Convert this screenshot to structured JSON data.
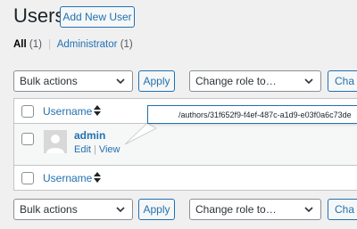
{
  "header": {
    "title": "Users",
    "add_new_label": "Add New User"
  },
  "views": {
    "all_label": "All",
    "all_count": "(1)",
    "separator": "|",
    "admin_label": "Administrator",
    "admin_count": "(1)"
  },
  "bulk_top": {
    "selected": "Bulk actions",
    "apply_label": "Apply"
  },
  "role_top": {
    "selected": "Change role to…",
    "change_label": "Cha"
  },
  "table": {
    "column_username": "Username"
  },
  "rows": [
    {
      "login": "admin",
      "edit_label": "Edit",
      "view_label": "View",
      "separator": "|"
    }
  ],
  "tooltip": {
    "text": "/authors/31f652f9-f4ef-487c-a1d9-e03f0a6c73de"
  },
  "bulk_bottom": {
    "selected": "Bulk actions",
    "apply_label": "Apply"
  },
  "role_bottom": {
    "selected": "Change role to…",
    "change_label": "Cha"
  },
  "icons": {
    "dropdown": "chevron-down-icon",
    "sort": "sort-arrows-icon",
    "avatar": "avatar-placeholder-icon"
  },
  "colors": {
    "accent": "#2271b1",
    "background": "#f0f0f1",
    "text": "#1d2327"
  }
}
